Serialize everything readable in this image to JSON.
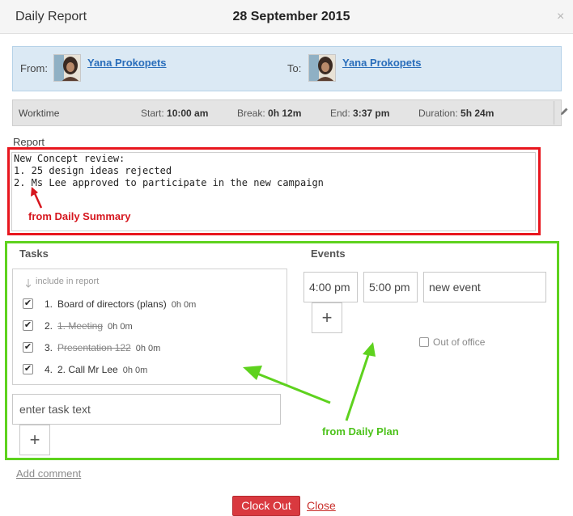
{
  "header": {
    "title": "Daily Report",
    "date": "28 September 2015",
    "close_icon": "close-icon"
  },
  "people": {
    "from_label": "From:",
    "from_name": "Yana Prokopets",
    "to_label": "To:",
    "to_name": "Yana Prokopets"
  },
  "worktime": {
    "label": "Worktime",
    "start_label": "Start:",
    "start": "10:00 am",
    "break_label": "Break:",
    "break": "0h 12m",
    "end_label": "End:",
    "end": "3:37 pm",
    "duration_label": "Duration:",
    "duration": "5h 24m",
    "edit_icon": "pencil-icon"
  },
  "report": {
    "heading": "Report",
    "lines": [
      "New Concept review:",
      "1. 25 design ideas rejected",
      "2. Ms Lee approved to participate in the new campaign"
    ],
    "annotation": "from Daily Summary"
  },
  "tasks": {
    "heading": "Tasks",
    "include_hint": "include in report",
    "items": [
      {
        "num": "1.",
        "text": "Board of directors (plans)",
        "duration": "0h 0m",
        "checked": true,
        "struck": false
      },
      {
        "num": "2.",
        "text": "1. Meeting",
        "duration": "0h 0m",
        "checked": true,
        "struck": true
      },
      {
        "num": "3.",
        "text": "Presentation 122",
        "duration": "0h 0m",
        "checked": true,
        "struck": true
      },
      {
        "num": "4.",
        "text": "2. Call Mr Lee",
        "duration": "0h 0m",
        "checked": true,
        "struck": false
      }
    ],
    "input_placeholder": "enter task text",
    "add_symbol": "+"
  },
  "events": {
    "heading": "Events",
    "start_time": "4:00 pm",
    "end_time": "5:00 pm",
    "name": "new event",
    "add_symbol": "+",
    "out_of_office_label": "Out of office"
  },
  "plan_annotation": "from Daily Plan",
  "footer": {
    "add_comment": "Add comment",
    "clock_out": "Clock Out",
    "close": "Close"
  },
  "colors": {
    "summary_highlight": "#e8161e",
    "plan_highlight": "#5ed21e",
    "link": "#2a6ebb",
    "clock_out": "#d9393f"
  }
}
